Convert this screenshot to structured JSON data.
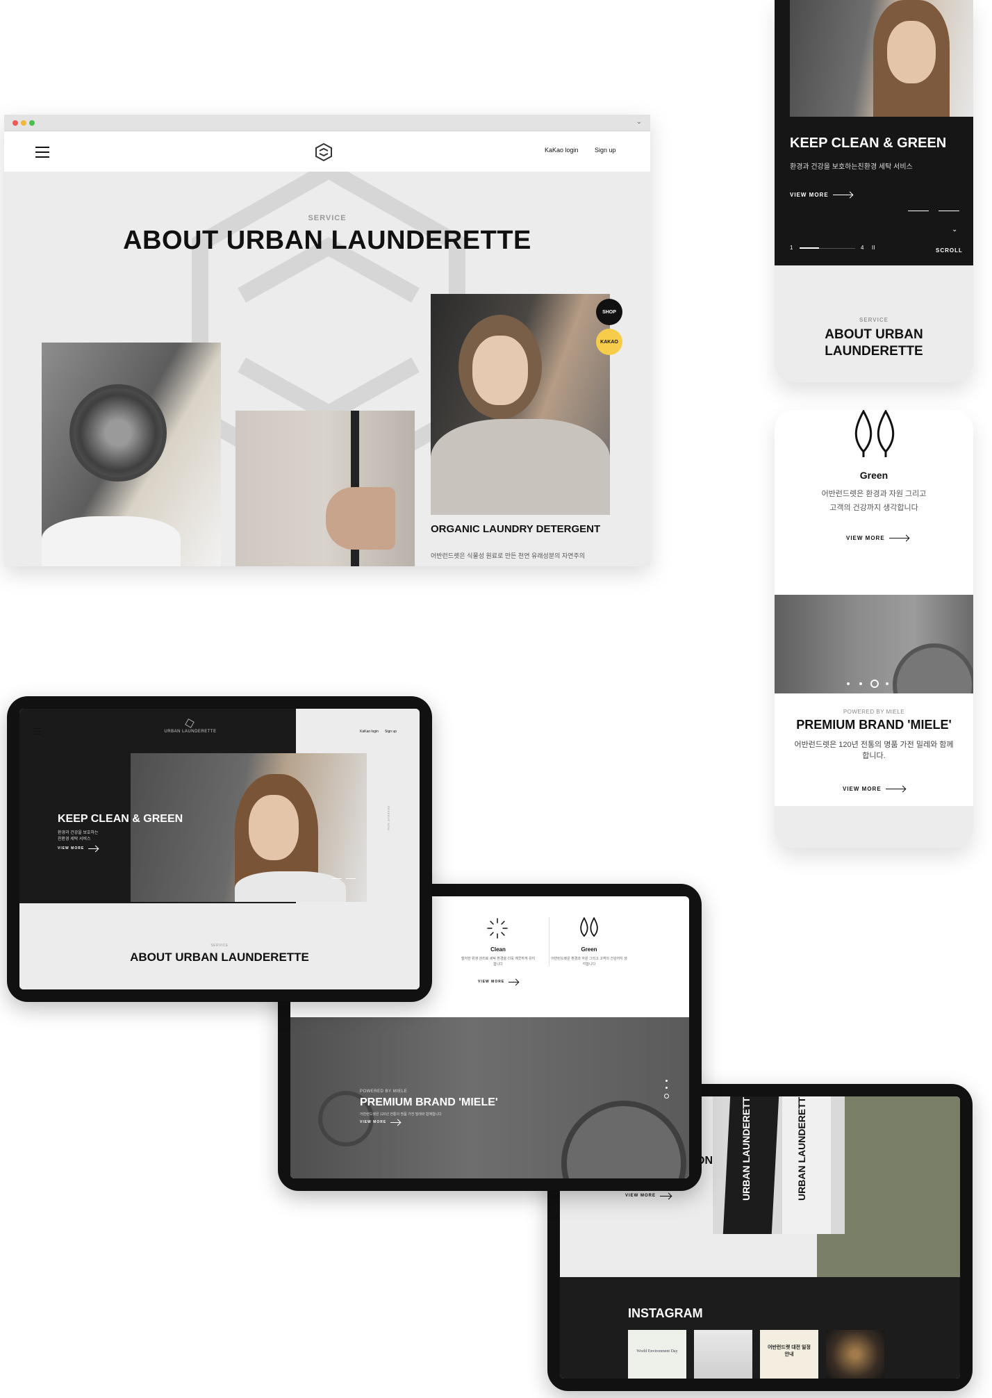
{
  "desktop": {
    "nav": {
      "kakao_login": "KaKao login",
      "sign_up": "Sign up"
    },
    "eyebrow": "SERVICE",
    "title": "ABOUT URBAN LAUNDERETTE",
    "badges": {
      "shop": "SHOP",
      "kakao": "KAKAO"
    },
    "card_title": "ORGANIC LAUNDRY DETERGENT",
    "card_desc": "어반런드렛은 식물성 원료로 만든 천연 유래성분의 자연주의"
  },
  "phone1": {
    "hero_title": "KEEP CLEAN & GREEN",
    "hero_sub": "환경과 건강을 보호하는친환경 세탁 서비스",
    "view_more": "VIEW MORE",
    "pager_start": "1",
    "pager_end": "4",
    "pause": "II",
    "scroll": "SCROLL",
    "eyebrow": "SERVICE",
    "about_title": "ABOUT URBAN LAUNDERETTE"
  },
  "phone2": {
    "green_title": "Green",
    "green_desc_1": "어반런드렛은 환경과 자원 그리고",
    "green_desc_2": "고객의 건강까지 생각합니다",
    "view_more": "VIEW MORE",
    "powered": "POWERED BY MIELE",
    "premium_title": "PREMIUM BRAND 'MIELE'",
    "premium_desc_1": "어반런드렛은 120년 전통의 명품 가전 밀레와 함께",
    "premium_desc_2": "합니다.",
    "view_more_2": "VIEW MORE"
  },
  "tablet1": {
    "brand": "URBAN LAUNDERETTE",
    "kakao_login": "KaKao login",
    "sign_up": "Sign up",
    "hero_title": "KEEP CLEAN & GREEN",
    "hero_sub_1": "환경과 건강을 보호하는",
    "hero_sub_2": "친환경 세탁 서비스",
    "view_more": "VIEW MORE",
    "side_label": "RESERVE NOW",
    "eyebrow": "SERVICE",
    "about_title": "ABOUT URBAN LAUNDERETTE"
  },
  "tablet2": {
    "clean_title": "Clean",
    "clean_desc": "철저한 위생 관리로 세탁 환경을 더욱 깨끗하게 유지합니다",
    "green_title": "Green",
    "green_desc": "어반런드렛은 환경과 자원 그리고 고객의 건강까지 생각합니다",
    "view_more": "VIEW MORE",
    "powered": "POWERED BY MIELE",
    "premium_title": "PREMIUM BRAND 'MIELE'",
    "premium_desc": "어반런드렛은 120년 전통의 명품 가전 밀레와 함께합니다",
    "view_more_2": "VIEW MORE"
  },
  "tablet3": {
    "partial_title": "ON",
    "view_more": "VIEW MORE",
    "instagram": "INSTAGRAM",
    "post1": "World Environment Day",
    "post3": "어반런드렛 대전 일정 안내",
    "bag_text_1": "URBAN LAUNDERETTE",
    "bag_text_2": "URBAN LAUNDERETTE"
  },
  "colors": {
    "dark": "#111111",
    "light_bg": "#ececec",
    "kakao_yellow": "#f6cd4a",
    "olive": "#7a8068",
    "grey_photo": "#6b6b6b"
  }
}
